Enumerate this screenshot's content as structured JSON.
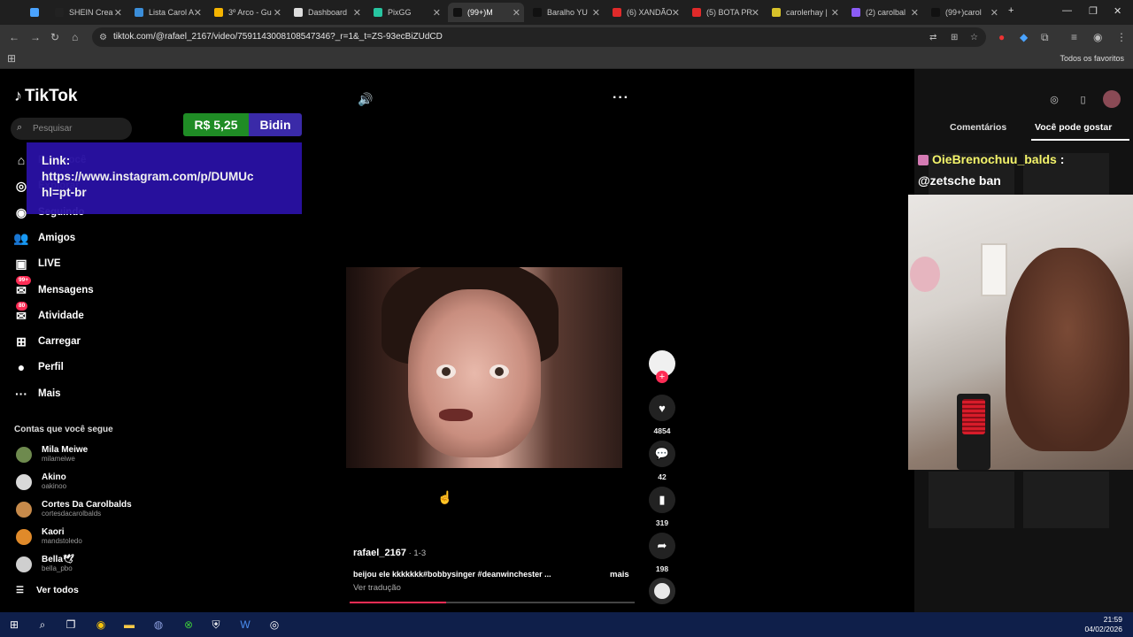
{
  "browser": {
    "tabs": [
      {
        "label": "",
        "color": "#4aa3ff"
      },
      {
        "label": "SHEIN Crea",
        "color": "#222222"
      },
      {
        "label": "Lista Carol A",
        "color": "#3b8ed9"
      },
      {
        "label": "3º Arco - Gu",
        "color": "#f5b400"
      },
      {
        "label": "Dashboard",
        "color": "#dddddd"
      },
      {
        "label": "PixGG",
        "color": "#27c5a0"
      },
      {
        "label": "(99+)M",
        "color": "#111111"
      },
      {
        "label": "Baralho YU",
        "color": "#111111"
      },
      {
        "label": "(6) XANDÃO",
        "color": "#e02a2a"
      },
      {
        "label": "(5) BOTA PR",
        "color": "#e02a2a"
      },
      {
        "label": "carolerhay |",
        "color": "#d7c22a"
      },
      {
        "label": "(2) carolbal",
        "color": "#8b5cf6"
      },
      {
        "label": "(99+)carol",
        "color": "#111111"
      }
    ],
    "active_tab_index": 6,
    "new_tab": "+",
    "url": "tiktok.com/@rafael_2167/video/7591143008108547346?_r=1&_t=ZS-93ecBiZUdCD",
    "bookmarks_all": "Todos os favoritos"
  },
  "tiktok": {
    "logo": "TikTok",
    "search_placeholder": "Pesquisar",
    "nav": [
      {
        "label": "Para você",
        "icon": "home-icon"
      },
      {
        "label": "Explorar",
        "icon": "compass-icon"
      },
      {
        "label": "Seguindo",
        "icon": "following-avatar-icon"
      },
      {
        "label": "Amigos",
        "icon": "friends-icon"
      },
      {
        "label": "LIVE",
        "icon": "live-icon"
      },
      {
        "label": "Mensagens",
        "icon": "messages-icon",
        "badge": "99+"
      },
      {
        "label": "Atividade",
        "icon": "activity-icon",
        "badge": "80"
      },
      {
        "label": "Carregar",
        "icon": "upload-icon"
      },
      {
        "label": "Perfil",
        "icon": "profile-icon"
      },
      {
        "label": "Mais",
        "icon": "more-icon"
      }
    ],
    "following_title": "Contas que você segue",
    "accounts": [
      {
        "name": "Mila Meiwe",
        "handle": "milameiwe",
        "color": "#6e8a4e"
      },
      {
        "name": "Akino",
        "handle": "oakinoo",
        "color": "#d9d9d9"
      },
      {
        "name": "Cortes Da Carolbalds",
        "handle": "cortesdacarolbalds",
        "color": "#c78a4a"
      },
      {
        "name": "Kaori",
        "handle": "mandstoledo",
        "color": "#e08a2a"
      },
      {
        "name": "Bella🕊",
        "handle": "bella_pbo",
        "color": "#cfcfcf"
      }
    ],
    "see_all": "Ver todos",
    "video": {
      "author": "rafael_2167",
      "date": " · 1-3",
      "caption": "beijou ele kkkkkkk#bobbysinger #deanwinchester ...",
      "caption_more": "mais",
      "translate": "Ver tradução",
      "likes": "4854",
      "comments": "42",
      "saves": "319",
      "shares": "198",
      "progress": 0.34
    },
    "right_panel": {
      "tab_comments": "Comentários",
      "tab_like": "Você pode gostar"
    }
  },
  "stream_overlay": {
    "price": "R$ 5,25",
    "price_name": "Bidin",
    "link_label": "Link:",
    "link_line1": "https://www.instagram.com/p/DUMUc",
    "link_line2": "hl=pt-br",
    "chat_user": "OieBrenochuu_balds",
    "chat_sep": " :",
    "chat_message": "@zetsche ban"
  },
  "taskbar": {
    "time": "21:59",
    "date": "04/02/2026"
  }
}
